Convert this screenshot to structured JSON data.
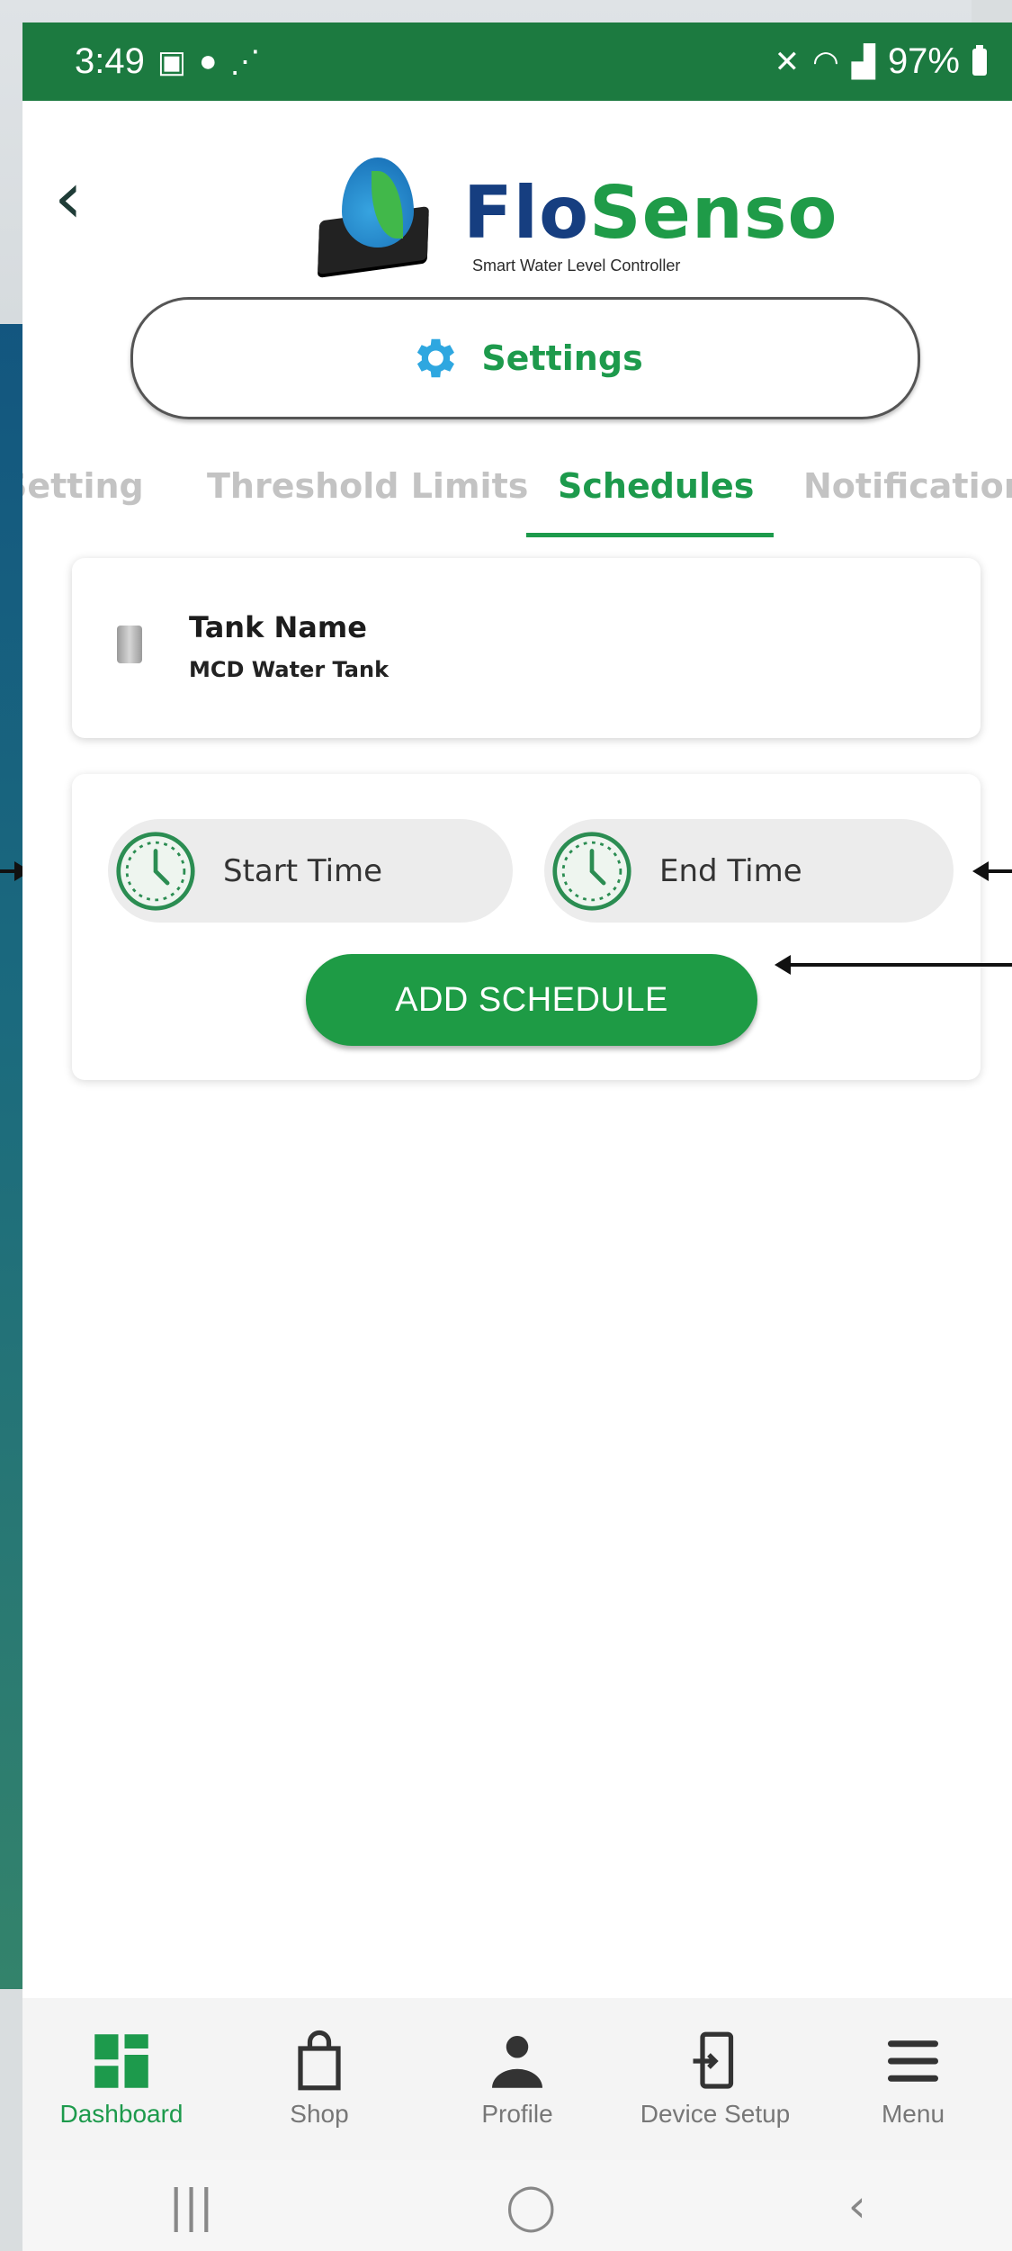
{
  "status_bar": {
    "time": "3:49",
    "left_icons": [
      "gallery-icon",
      "account-icon",
      "signal-activity-icon"
    ],
    "battery": "97%",
    "right_icons": [
      "mute-icon",
      "wifi-icon",
      "signal-icon",
      "battery-icon"
    ]
  },
  "header": {
    "brand_flo": "Flo",
    "brand_senso": "Senso",
    "tagline": "Smart Water Level Controller",
    "settings_label": "Settings"
  },
  "tabs": [
    {
      "label": "Setting",
      "active": false
    },
    {
      "label": "Threshold Limits",
      "active": false
    },
    {
      "label": "Schedules",
      "active": true
    },
    {
      "label": "Notification",
      "active": false
    }
  ],
  "tank": {
    "title": "Tank Name",
    "value": "MCD Water Tank"
  },
  "schedule": {
    "start_label": "Start Time",
    "end_label": "End Time",
    "add_button": "ADD SCHEDULE"
  },
  "bottom_nav": [
    {
      "label": "Dashboard",
      "icon": "dashboard-icon",
      "active": true
    },
    {
      "label": "Shop",
      "icon": "shopping-bag-icon",
      "active": false
    },
    {
      "label": "Profile",
      "icon": "profile-icon",
      "active": false
    },
    {
      "label": "Device Setup",
      "icon": "device-setup-icon",
      "active": false
    },
    {
      "label": "Menu",
      "icon": "menu-icon",
      "active": false
    }
  ],
  "system_nav": {
    "recents": "|||",
    "home": "◯",
    "back": "‹"
  },
  "colors": {
    "accent_green": "#1d9a4c",
    "status_bar": "#1c7a40",
    "brand_blue": "#163e80"
  }
}
